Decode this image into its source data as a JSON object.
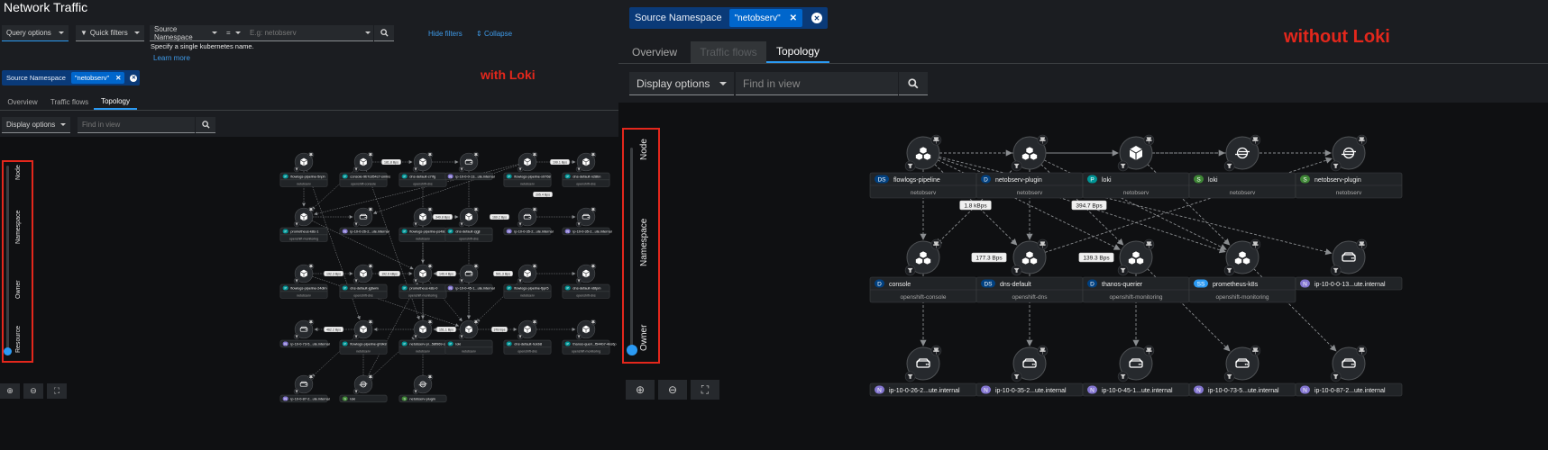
{
  "left": {
    "page_title": "Network Traffic",
    "annotation": "with Loki",
    "toolbar": {
      "query_options": "Query options",
      "quick_filters": "Quick filters",
      "filter_field": "Source Namespace",
      "filter_operator": "=",
      "filter_placeholder": "E.g: netobserv",
      "helper_text": "Specify a single kubernetes name.",
      "learn_more": "Learn more",
      "hide_filters": "Hide filters",
      "collapse": "Collapse"
    },
    "chip_group": {
      "label": "Source Namespace",
      "chip": "\"netobserv\""
    },
    "tabs": [
      {
        "label": "Overview",
        "state": "normal"
      },
      {
        "label": "Traffic flows",
        "state": "normal"
      },
      {
        "label": "Topology",
        "state": "active"
      }
    ],
    "display_options": "Display options",
    "find_placeholder": "Find in view",
    "scope_slider": {
      "levels": [
        "Node",
        "Namespace",
        "Owner",
        "Resource"
      ],
      "selected": "Resource"
    },
    "graph": {
      "nodes": [
        {
          "badge": "P",
          "name": "flowlogs-pipeline-5nph",
          "ns": "netobserv",
          "icon": "pod"
        },
        {
          "badge": "P",
          "name": "console-9b7cd54c7-smlns",
          "ns": "openshift-console",
          "icon": "pod"
        },
        {
          "badge": "P",
          "name": "dns-default-c7rfg",
          "ns": "openshift-dns",
          "icon": "pod"
        },
        {
          "badge": "N",
          "name": "ip-10-0-0-13...ute.internal",
          "ns": "",
          "icon": "node"
        },
        {
          "badge": "P",
          "name": "flowlogs-pipeline-x9768",
          "ns": "netobserv",
          "icon": "pod"
        },
        {
          "badge": "P",
          "name": "dns-default-n28bn",
          "ns": "openshift-dns",
          "icon": "pod"
        },
        {
          "badge": "P",
          "name": "prometheus-k8s-1",
          "ns": "openshift-monitoring",
          "icon": "pod"
        },
        {
          "badge": "N",
          "name": "ip-10-0-26-2...ute.internal",
          "ns": "",
          "icon": "node"
        },
        {
          "badge": "P",
          "name": "flowlogs-pipeline-ps48q",
          "ns": "netobserv",
          "icon": "pod"
        },
        {
          "badge": "P",
          "name": "dns-default-zjgjl",
          "ns": "openshift-dns",
          "icon": "pod"
        },
        {
          "badge": "N",
          "name": "ip-10-0-35-2...ute.internal",
          "ns": "",
          "icon": "node"
        },
        {
          "badge": "N",
          "name": "ip-10-0-35-2...ute.internal",
          "ns": "",
          "icon": "node"
        },
        {
          "badge": "P",
          "name": "flowlogs-pipeline-24dlm",
          "ns": "netobserv",
          "icon": "pod"
        },
        {
          "badge": "P",
          "name": "dns-default-jg6wm",
          "ns": "openshift-dns",
          "icon": "pod"
        },
        {
          "badge": "P",
          "name": "prometheus-k8s-0",
          "ns": "openshift-monitoring",
          "icon": "pod"
        },
        {
          "badge": "N",
          "name": "ip-10-0-45-1...ute.internal",
          "ns": "",
          "icon": "node"
        },
        {
          "badge": "P",
          "name": "flowlogs-pipeline-fjqn5",
          "ns": "netobserv",
          "icon": "pod"
        },
        {
          "badge": "P",
          "name": "dns-default-n6tpm",
          "ns": "openshift-dns",
          "icon": "pod"
        },
        {
          "badge": "N",
          "name": "ip-10-0-73-5...ute.internal",
          "ns": "",
          "icon": "node"
        },
        {
          "badge": "P",
          "name": "flowlogs-pipeline-gh9k8",
          "ns": "netobserv",
          "icon": "pod"
        },
        {
          "badge": "P",
          "name": "netobserv-pl...58f969-sz7kd",
          "ns": "netobserv",
          "icon": "pod"
        },
        {
          "badge": "P",
          "name": "loki",
          "ns": "netobserv",
          "icon": "pod"
        },
        {
          "badge": "P",
          "name": "dns-default-hckb8",
          "ns": "openshift-dns",
          "icon": "pod"
        },
        {
          "badge": "P",
          "name": "thanos-queri...f544b7-4ns6p",
          "ns": "openshift-monitoring",
          "icon": "pod"
        },
        {
          "badge": "N",
          "name": "ip-10-0-87-2...ute.internal",
          "ns": "",
          "icon": "node"
        },
        {
          "badge": "S",
          "name": "loki",
          "ns": "",
          "icon": "service"
        },
        {
          "badge": "S",
          "name": "netobserv-plugin",
          "ns": "",
          "icon": "service"
        }
      ],
      "edge_labels": [
        "181.8 Bps",
        "190.1 Bps",
        "349.8 Bps",
        "160.2 Bps",
        "205.4 Bps",
        "192.3 Bps",
        "192.6 kBps",
        "149.4 Bps",
        "501.3 Bps",
        "462.2 Bps",
        "151.1 Bps",
        "378 Bps"
      ]
    }
  },
  "right": {
    "annotation": "without Loki",
    "chip_group": {
      "label": "Source Namespace",
      "chip": "\"netobserv\""
    },
    "tabs": [
      {
        "label": "Overview",
        "state": "normal"
      },
      {
        "label": "Traffic flows",
        "state": "disabled"
      },
      {
        "label": "Topology",
        "state": "active"
      }
    ],
    "display_options": "Display options",
    "find_placeholder": "Find in view",
    "scope_slider": {
      "levels": [
        "Node",
        "Namespace",
        "Owner"
      ],
      "selected": "Owner"
    },
    "graph": {
      "nodes": [
        {
          "badge": "DS",
          "name": "flowlogs-pipeline",
          "ns": "netobserv",
          "icon": "owner"
        },
        {
          "badge": "D",
          "name": "netobserv-plugin",
          "ns": "netobserv",
          "icon": "owner"
        },
        {
          "badge": "P",
          "name": "loki",
          "ns": "netobserv",
          "icon": "pod"
        },
        {
          "badge": "S",
          "name": "loki",
          "ns": "netobserv",
          "icon": "service"
        },
        {
          "badge": "S",
          "name": "netobserv-plugin",
          "ns": "netobserv",
          "icon": "service"
        },
        {
          "badge": "D",
          "name": "console",
          "ns": "openshift-console",
          "icon": "owner"
        },
        {
          "badge": "DS",
          "name": "dns-default",
          "ns": "openshift-dns",
          "icon": "owner"
        },
        {
          "badge": "D",
          "name": "thanos-querier",
          "ns": "openshift-monitoring",
          "icon": "owner"
        },
        {
          "badge": "SS",
          "name": "prometheus-k8s",
          "ns": "openshift-monitoring",
          "icon": "owner"
        },
        {
          "badge": "N",
          "name": "ip-10-0-0-13...ute.internal",
          "ns": "",
          "icon": "node"
        },
        {
          "badge": "N",
          "name": "ip-10-0-26-2...ute.internal",
          "ns": "",
          "icon": "node"
        },
        {
          "badge": "N",
          "name": "ip-10-0-35-2...ute.internal",
          "ns": "",
          "icon": "node"
        },
        {
          "badge": "N",
          "name": "ip-10-0-45-1...ute.internal",
          "ns": "",
          "icon": "node"
        },
        {
          "badge": "N",
          "name": "ip-10-0-73-5...ute.internal",
          "ns": "",
          "icon": "node"
        },
        {
          "badge": "N",
          "name": "ip-10-0-87-2...ute.internal",
          "ns": "",
          "icon": "node"
        }
      ],
      "edge_labels": [
        "1.8 kBps",
        "394.7 Bps",
        "177.3 Bps",
        "139.3 Bps"
      ]
    }
  },
  "colors": {
    "badge_P": "#009596",
    "badge_N": "#8476d1",
    "badge_S": "#3e8635",
    "badge_D": "#004080",
    "badge_DS": "#004080",
    "badge_SS": "#2b9af3",
    "accent": "#2b9af3",
    "annotation": "#e3271c"
  }
}
